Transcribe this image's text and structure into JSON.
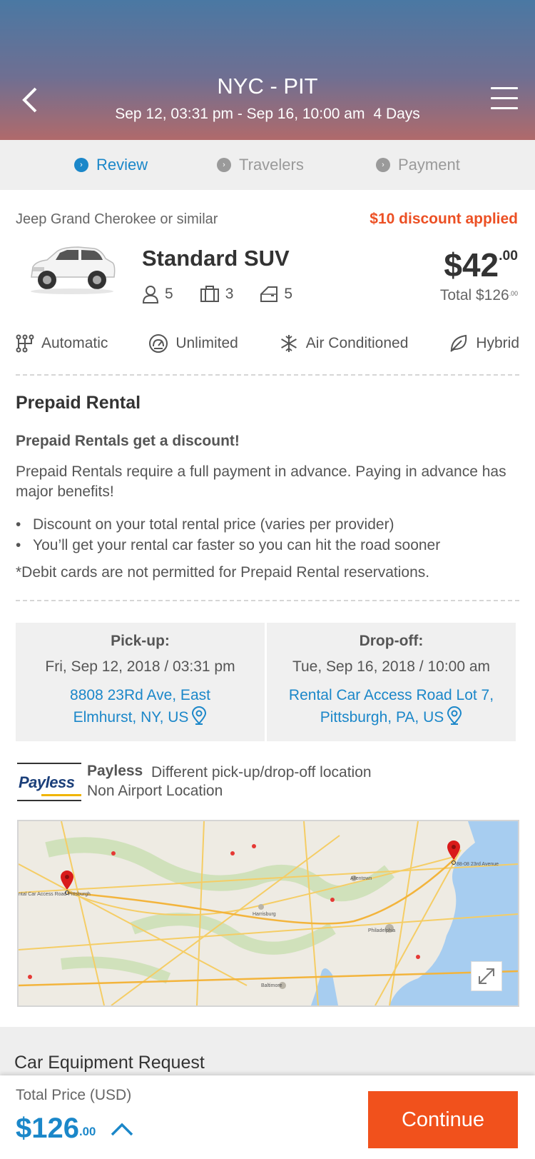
{
  "header": {
    "route": "NYC - PIT",
    "dates": "Sep 12, 03:31 pm - Sep 16, 10:00 am",
    "duration": "4 Days"
  },
  "steps": [
    {
      "label": "Review",
      "active": true
    },
    {
      "label": "Travelers",
      "active": false
    },
    {
      "label": "Payment",
      "active": false
    }
  ],
  "car": {
    "similar": "Jeep Grand Cherokee or similar",
    "discount": "$10 discount applied",
    "class": "Standard SUV",
    "price_main": "$42",
    "price_cents": ".00",
    "total_main": "Total $126",
    "total_cents": ".00",
    "passengers": "5",
    "bags": "3",
    "doors": "5",
    "features": [
      "Automatic",
      "Unlimited",
      "Air Conditioned",
      "Hybrid"
    ]
  },
  "prepaid": {
    "title": "Prepaid Rental",
    "subtitle": "Prepaid Rentals get a discount!",
    "body": "Prepaid Rentals require a full payment in advance. Paying in advance has major benefits!",
    "bullets": [
      "Discount on your total rental price (varies per provider)",
      "You’ll get your rental car faster so you can hit the road sooner"
    ],
    "note": "*Debit cards are not permitted for Prepaid Rental reservations."
  },
  "pickup": {
    "label": "Pick-up:",
    "datetime": "Fri, Sep 12, 2018 / 03:31 pm",
    "address_line1": "8808 23Rd Ave, East",
    "address_line2": "Elmhurst, NY, US"
  },
  "dropoff": {
    "label": "Drop-off:",
    "datetime": "Tue, Sep 16, 2018 / 10:00 am",
    "address_line1": "Rental Car Access Road Lot 7,",
    "address_line2": "Pittsburgh, PA, US"
  },
  "vendor": {
    "logo_text": "Payless",
    "name": "Payless",
    "description": "Different pick-up/drop-off location",
    "location_type": "Non Airport Location"
  },
  "map": {
    "labels": {
      "pit": "ntal Car Access Road  Pittsburgh",
      "nyc": "88-08 23rd Avenue",
      "philadelphia": "Philadelphia",
      "baltimore": "Baltimore",
      "allentown": "Allentown",
      "harrisburg": "Harrisburg"
    }
  },
  "equipment": {
    "title": "Car Equipment Request"
  },
  "footer": {
    "total_label": "Total Price (USD)",
    "price_main": "$126",
    "price_cents": ".00",
    "continue_label": "Continue"
  },
  "colors": {
    "accent_blue": "#1b87c9",
    "accent_orange": "#f1511c",
    "discount_red": "#ec5024"
  }
}
